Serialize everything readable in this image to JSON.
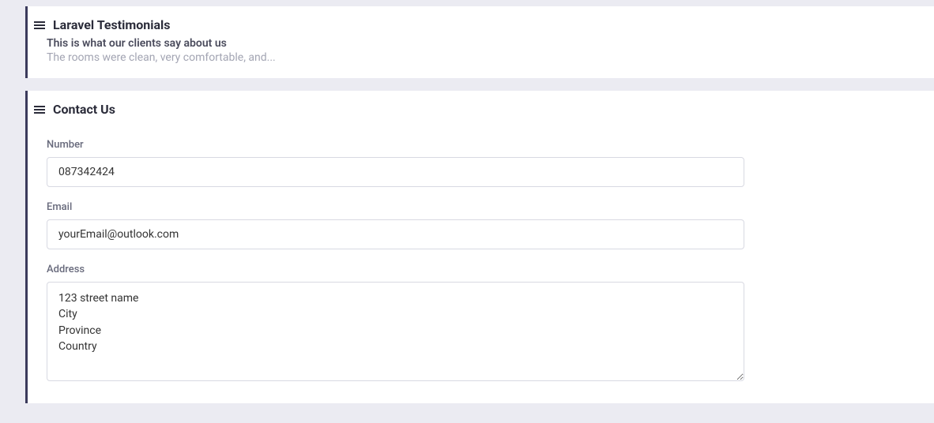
{
  "testimonials": {
    "title": "Laravel Testimonials",
    "subtitle": "This is what our clients say about us",
    "preview": "The rooms were clean, very comfortable, and..."
  },
  "contact": {
    "title": "Contact Us",
    "fields": {
      "number": {
        "label": "Number",
        "value": "087342424"
      },
      "email": {
        "label": "Email",
        "value": "yourEmail@outlook.com"
      },
      "address": {
        "label": "Address",
        "value": "123 street name\nCity\nProvince\nCountry"
      }
    }
  }
}
